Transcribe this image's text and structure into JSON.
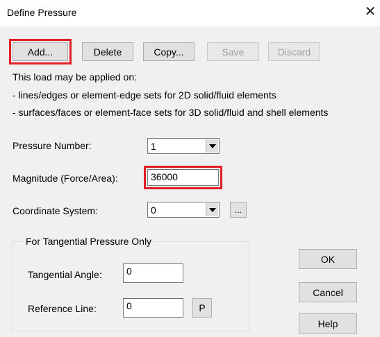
{
  "window": {
    "title": "Define Pressure",
    "close_glyph": "✕"
  },
  "toolbar": {
    "add_label": "Add...",
    "delete_label": "Delete",
    "copy_label": "Copy...",
    "save_label": "Save",
    "discard_label": "Discard"
  },
  "info": {
    "line1": "This load may be applied on:",
    "line2": "- lines/edges or element-edge sets for 2D solid/fluid elements",
    "line3": "- surfaces/faces or element-face sets for 3D solid/fluid and shell elements"
  },
  "form": {
    "pressure_number_label": "Pressure Number:",
    "pressure_number_value": "1",
    "magnitude_label": "Magnitude (Force/Area):",
    "magnitude_value": "36000",
    "coordinate_system_label": "Coordinate System:",
    "coordinate_system_value": "0",
    "coordinate_browse_label": "..."
  },
  "tangential": {
    "group_title": "For Tangential Pressure Only",
    "angle_label": "Tangential Angle:",
    "angle_value": "0",
    "reference_line_label": "Reference Line:",
    "reference_line_value": "0",
    "pick_label": "P"
  },
  "actions": {
    "ok_label": "OK",
    "cancel_label": "Cancel",
    "help_label": "Help"
  },
  "icons": {
    "close": "close-icon",
    "dropdown": "chevron-down-icon"
  },
  "colors": {
    "highlight": "#e01e25",
    "dialog_bg": "#f0f0f0",
    "disabled_text": "#a0a0a0"
  }
}
